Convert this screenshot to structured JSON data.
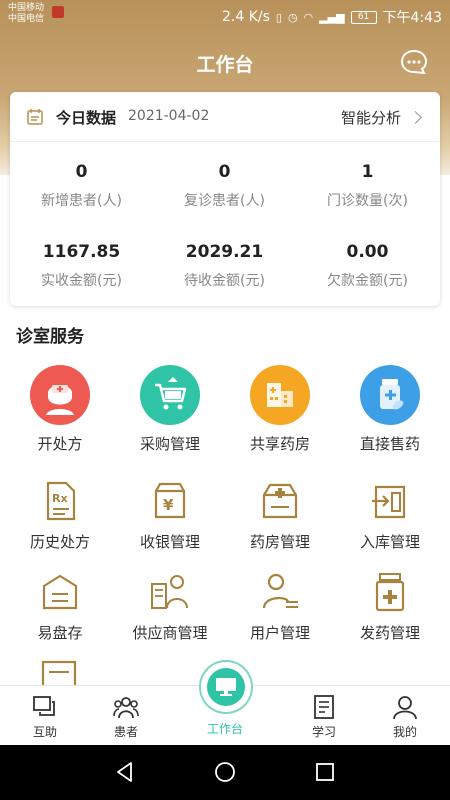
{
  "status": {
    "carrier_line1": "中国移动",
    "carrier_line2": "中国电信",
    "speed": "2.4 K/s",
    "battery": "61",
    "time": "下午4:43"
  },
  "header": {
    "title": "工作台"
  },
  "today": {
    "title": "今日数据",
    "date": "2021-04-02",
    "analysis_label": "智能分析",
    "stats": [
      {
        "value": "0",
        "label": "新增患者(人)"
      },
      {
        "value": "0",
        "label": "复诊患者(人)"
      },
      {
        "value": "1",
        "label": "门诊数量(次)"
      },
      {
        "value": "1167.85",
        "label": "实收金额(元)"
      },
      {
        "value": "2029.21",
        "label": "待收金额(元)"
      },
      {
        "value": "0.00",
        "label": "欠款金额(元)"
      }
    ]
  },
  "services": {
    "title": "诊室服务",
    "items": [
      {
        "label": "开处方",
        "icon": "doctor-icon"
      },
      {
        "label": "采购管理",
        "icon": "cart-icon"
      },
      {
        "label": "共享药房",
        "icon": "pharmacy-building-icon"
      },
      {
        "label": "直接售药",
        "icon": "medicine-bottle-icon"
      },
      {
        "label": "历史处方",
        "icon": "prescription-icon"
      },
      {
        "label": "收银管理",
        "icon": "cashier-icon"
      },
      {
        "label": "药房管理",
        "icon": "medicine-box-icon"
      },
      {
        "label": "入库管理",
        "icon": "stock-in-icon"
      },
      {
        "label": "易盘存",
        "icon": "inventory-icon"
      },
      {
        "label": "供应商管理",
        "icon": "supplier-icon"
      },
      {
        "label": "用户管理",
        "icon": "user-manage-icon"
      },
      {
        "label": "发药管理",
        "icon": "dispense-icon"
      }
    ]
  },
  "tabs": [
    {
      "label": "互助",
      "icon": "chat-icon"
    },
    {
      "label": "患者",
      "icon": "patients-icon"
    },
    {
      "label": "工作台",
      "icon": "monitor-icon",
      "active": true
    },
    {
      "label": "学习",
      "icon": "notebook-icon"
    },
    {
      "label": "我的",
      "icon": "profile-icon"
    }
  ],
  "colors": {
    "header": "#c9a673",
    "accent_teal": "#2ec4a5",
    "icon_gold": "#a8823f",
    "text_muted": "#888888"
  }
}
